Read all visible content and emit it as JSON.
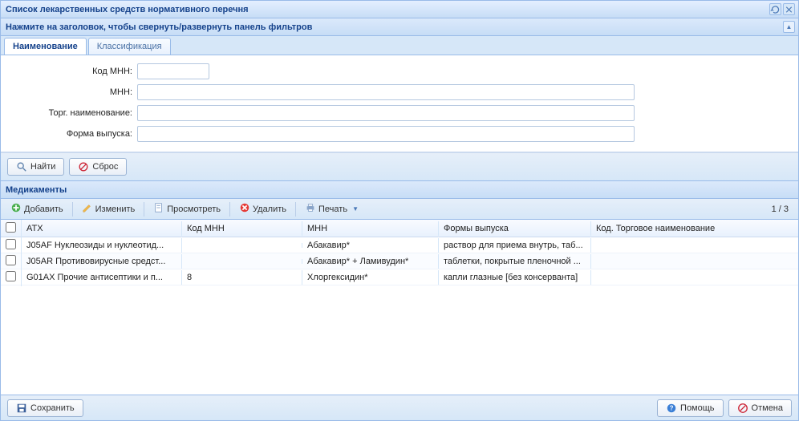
{
  "window": {
    "title": "Список лекарственных средств нормативного перечня"
  },
  "filter": {
    "header": "Нажмите на заголовок, чтобы свернуть/развернуть панель фильтров",
    "tabs": [
      {
        "label": "Наименование",
        "active": true
      },
      {
        "label": "Классификация",
        "active": false
      }
    ],
    "labels": {
      "code_mnn": "Код МНН:",
      "mnn": "МНН:",
      "trade_name": "Торг. наименование:",
      "release_form": "Форма выпуска:"
    },
    "values": {
      "code_mnn": "",
      "mnn": "",
      "trade_name": "",
      "release_form": ""
    },
    "buttons": {
      "find": "Найти",
      "reset": "Сброс"
    }
  },
  "grid": {
    "title": "Медикаменты",
    "toolbar": {
      "add": "Добавить",
      "edit": "Изменить",
      "view": "Просмотреть",
      "delete": "Удалить",
      "print": "Печать"
    },
    "paging": "1 / 3",
    "columns": {
      "atc": "АТХ",
      "code_mnn": "Код МНН",
      "mnn": "МНН",
      "release_form": "Формы выпуска",
      "trade": "Код. Торговое наименование"
    },
    "rows": [
      {
        "atc": "J05AF Нуклеозиды и нуклеотид...",
        "code_mnn": "",
        "mnn": "Абакавир*",
        "release_form": "раствор для приема внутрь, таб...",
        "trade": ""
      },
      {
        "atc": "J05AR Противовирусные средст...",
        "code_mnn": "",
        "mnn": "Абакавир* + Ламивудин*",
        "release_form": "таблетки, покрытые пленочной ...",
        "trade": ""
      },
      {
        "atc": "G01AX Прочие антисептики и п...",
        "code_mnn": "8",
        "mnn": "Хлоргексидин*",
        "release_form": "капли глазные [без консерванта]",
        "trade": ""
      }
    ]
  },
  "bottom": {
    "save": "Сохранить",
    "help": "Помощь",
    "cancel": "Отмена"
  }
}
